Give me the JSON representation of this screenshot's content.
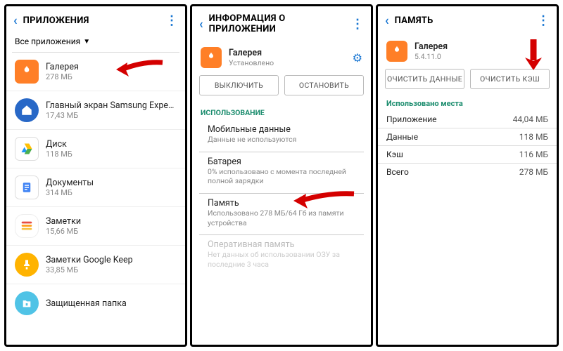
{
  "p1": {
    "title": "ПРИЛОЖЕНИЯ",
    "filter": "Все приложения",
    "apps": [
      {
        "name": "Галерея",
        "size": "278 МБ"
      },
      {
        "name": "Главный экран Samsung Experie..",
        "size": "17,43 МБ"
      },
      {
        "name": "Диск",
        "size": "118 МБ"
      },
      {
        "name": "Документы",
        "size": "314 МБ"
      },
      {
        "name": "Заметки",
        "size": "15,66 МБ"
      },
      {
        "name": "Заметки Google Keep",
        "size": "33,85 МБ"
      },
      {
        "name": "Защищенная папка",
        "size": ""
      }
    ]
  },
  "p2": {
    "title": "ИНФОРМАЦИЯ О ПРИЛОЖЕНИИ",
    "app_name": "Галерея",
    "installed": "Установлено",
    "btn_disable": "ВЫКЛЮЧИТЬ",
    "btn_stop": "ОСТАНОВИТЬ",
    "usage_title": "ИСПОЛЬЗОВАНИЕ",
    "rows": {
      "mobile_l": "Мобильные данные",
      "mobile_s": "Данные не используются",
      "batt_l": "Батарея",
      "batt_s": "0% использовано с момента последней полной зарядки",
      "mem_l": "Память",
      "mem_s": "Использовано 278 МБ/64 Гб из памяти устройства",
      "ram_l": "Оперативная память",
      "ram_s": "Нет данных об использовании ОЗУ за последние 3 часа"
    }
  },
  "p3": {
    "title": "ПАМЯТЬ",
    "app_name": "Галерея",
    "version": "5.4.11.0",
    "btn_cleardata": "ОЧИСТИТЬ ДАННЫЕ",
    "btn_clearcache": "ОЧИСТИТЬ КЭШ",
    "used_title": "Использовано места",
    "kv": [
      {
        "k": "Приложение",
        "v": "44,04 МБ"
      },
      {
        "k": "Данные",
        "v": "118 МБ"
      },
      {
        "k": "Кэш",
        "v": "116 МБ"
      },
      {
        "k": "Всего",
        "v": "278 МБ"
      }
    ]
  }
}
